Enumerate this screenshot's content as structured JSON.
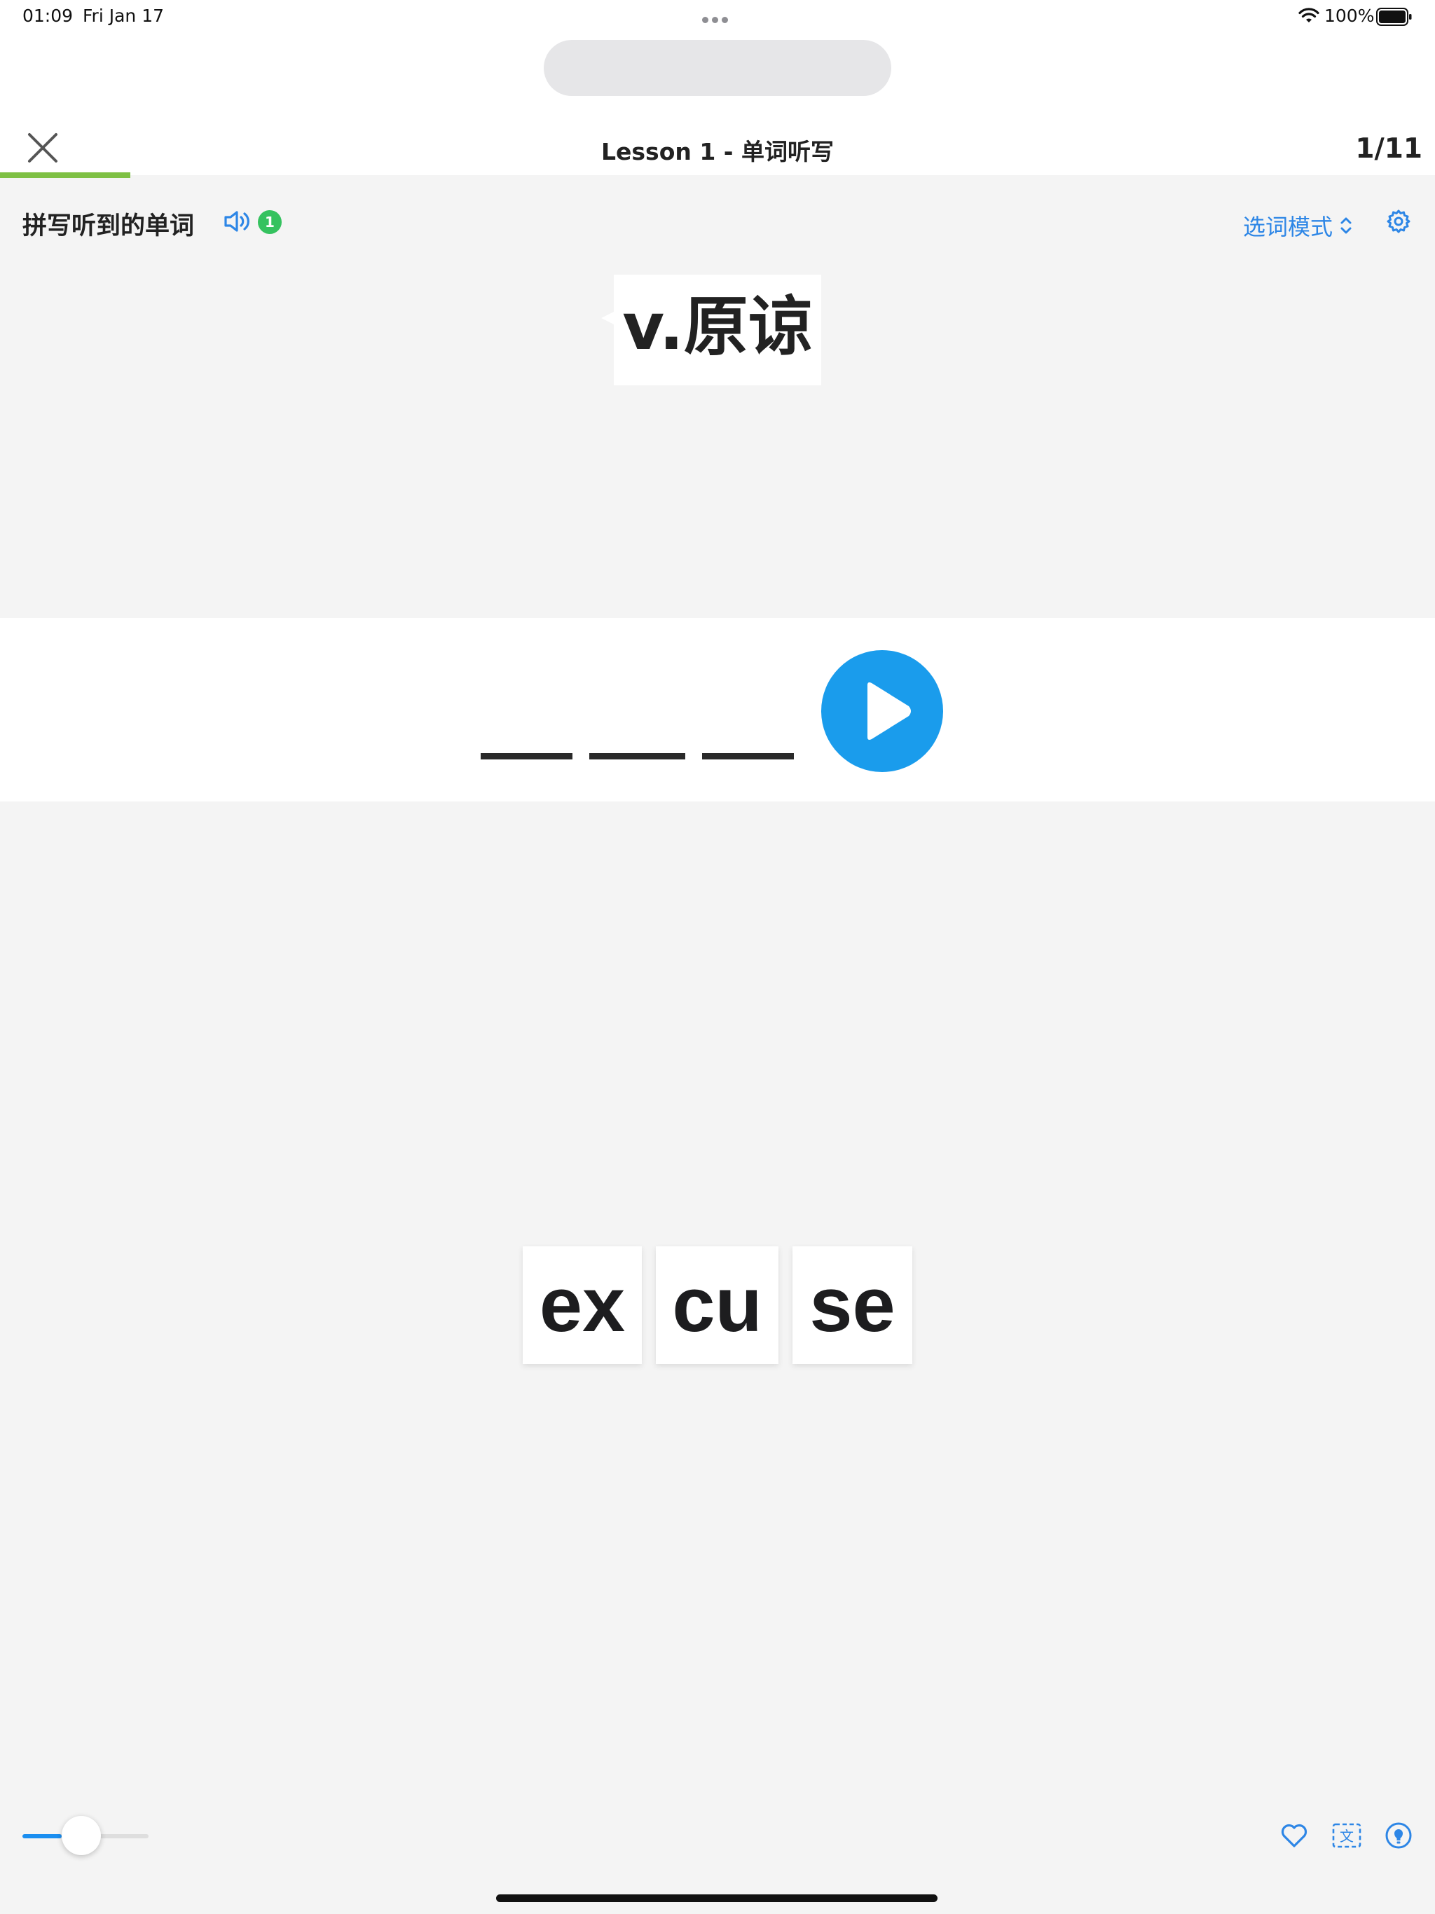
{
  "status_bar": {
    "time": "01:09",
    "date": "Fri Jan 17",
    "battery": "100%"
  },
  "header": {
    "title": "Lesson 1 - 单词听写",
    "counter": "1/11",
    "progress_fraction": 0.0909,
    "progress_color": "#7ec044"
  },
  "prompt": {
    "label": "拼写听到的单词",
    "play_count": "1",
    "mode_label": "选词模式"
  },
  "meaning": {
    "text": "v.原谅"
  },
  "answer": {
    "slots": 3
  },
  "tiles": [
    {
      "label": "ex"
    },
    {
      "label": "cu"
    },
    {
      "label": "se"
    }
  ],
  "speed_slider": {
    "fraction": 0.31,
    "accent_color": "#1a8ef0"
  },
  "colors": {
    "accent_blue": "#2d86e6",
    "play_button": "#1a9cec",
    "badge_green": "#35c25f"
  },
  "icons": {
    "close": "close-icon",
    "speaker": "speaker-icon",
    "settings": "gear-icon",
    "play": "play-icon",
    "heart": "heart-icon",
    "translate": "translate-icon",
    "hint": "lightbulb-icon"
  }
}
